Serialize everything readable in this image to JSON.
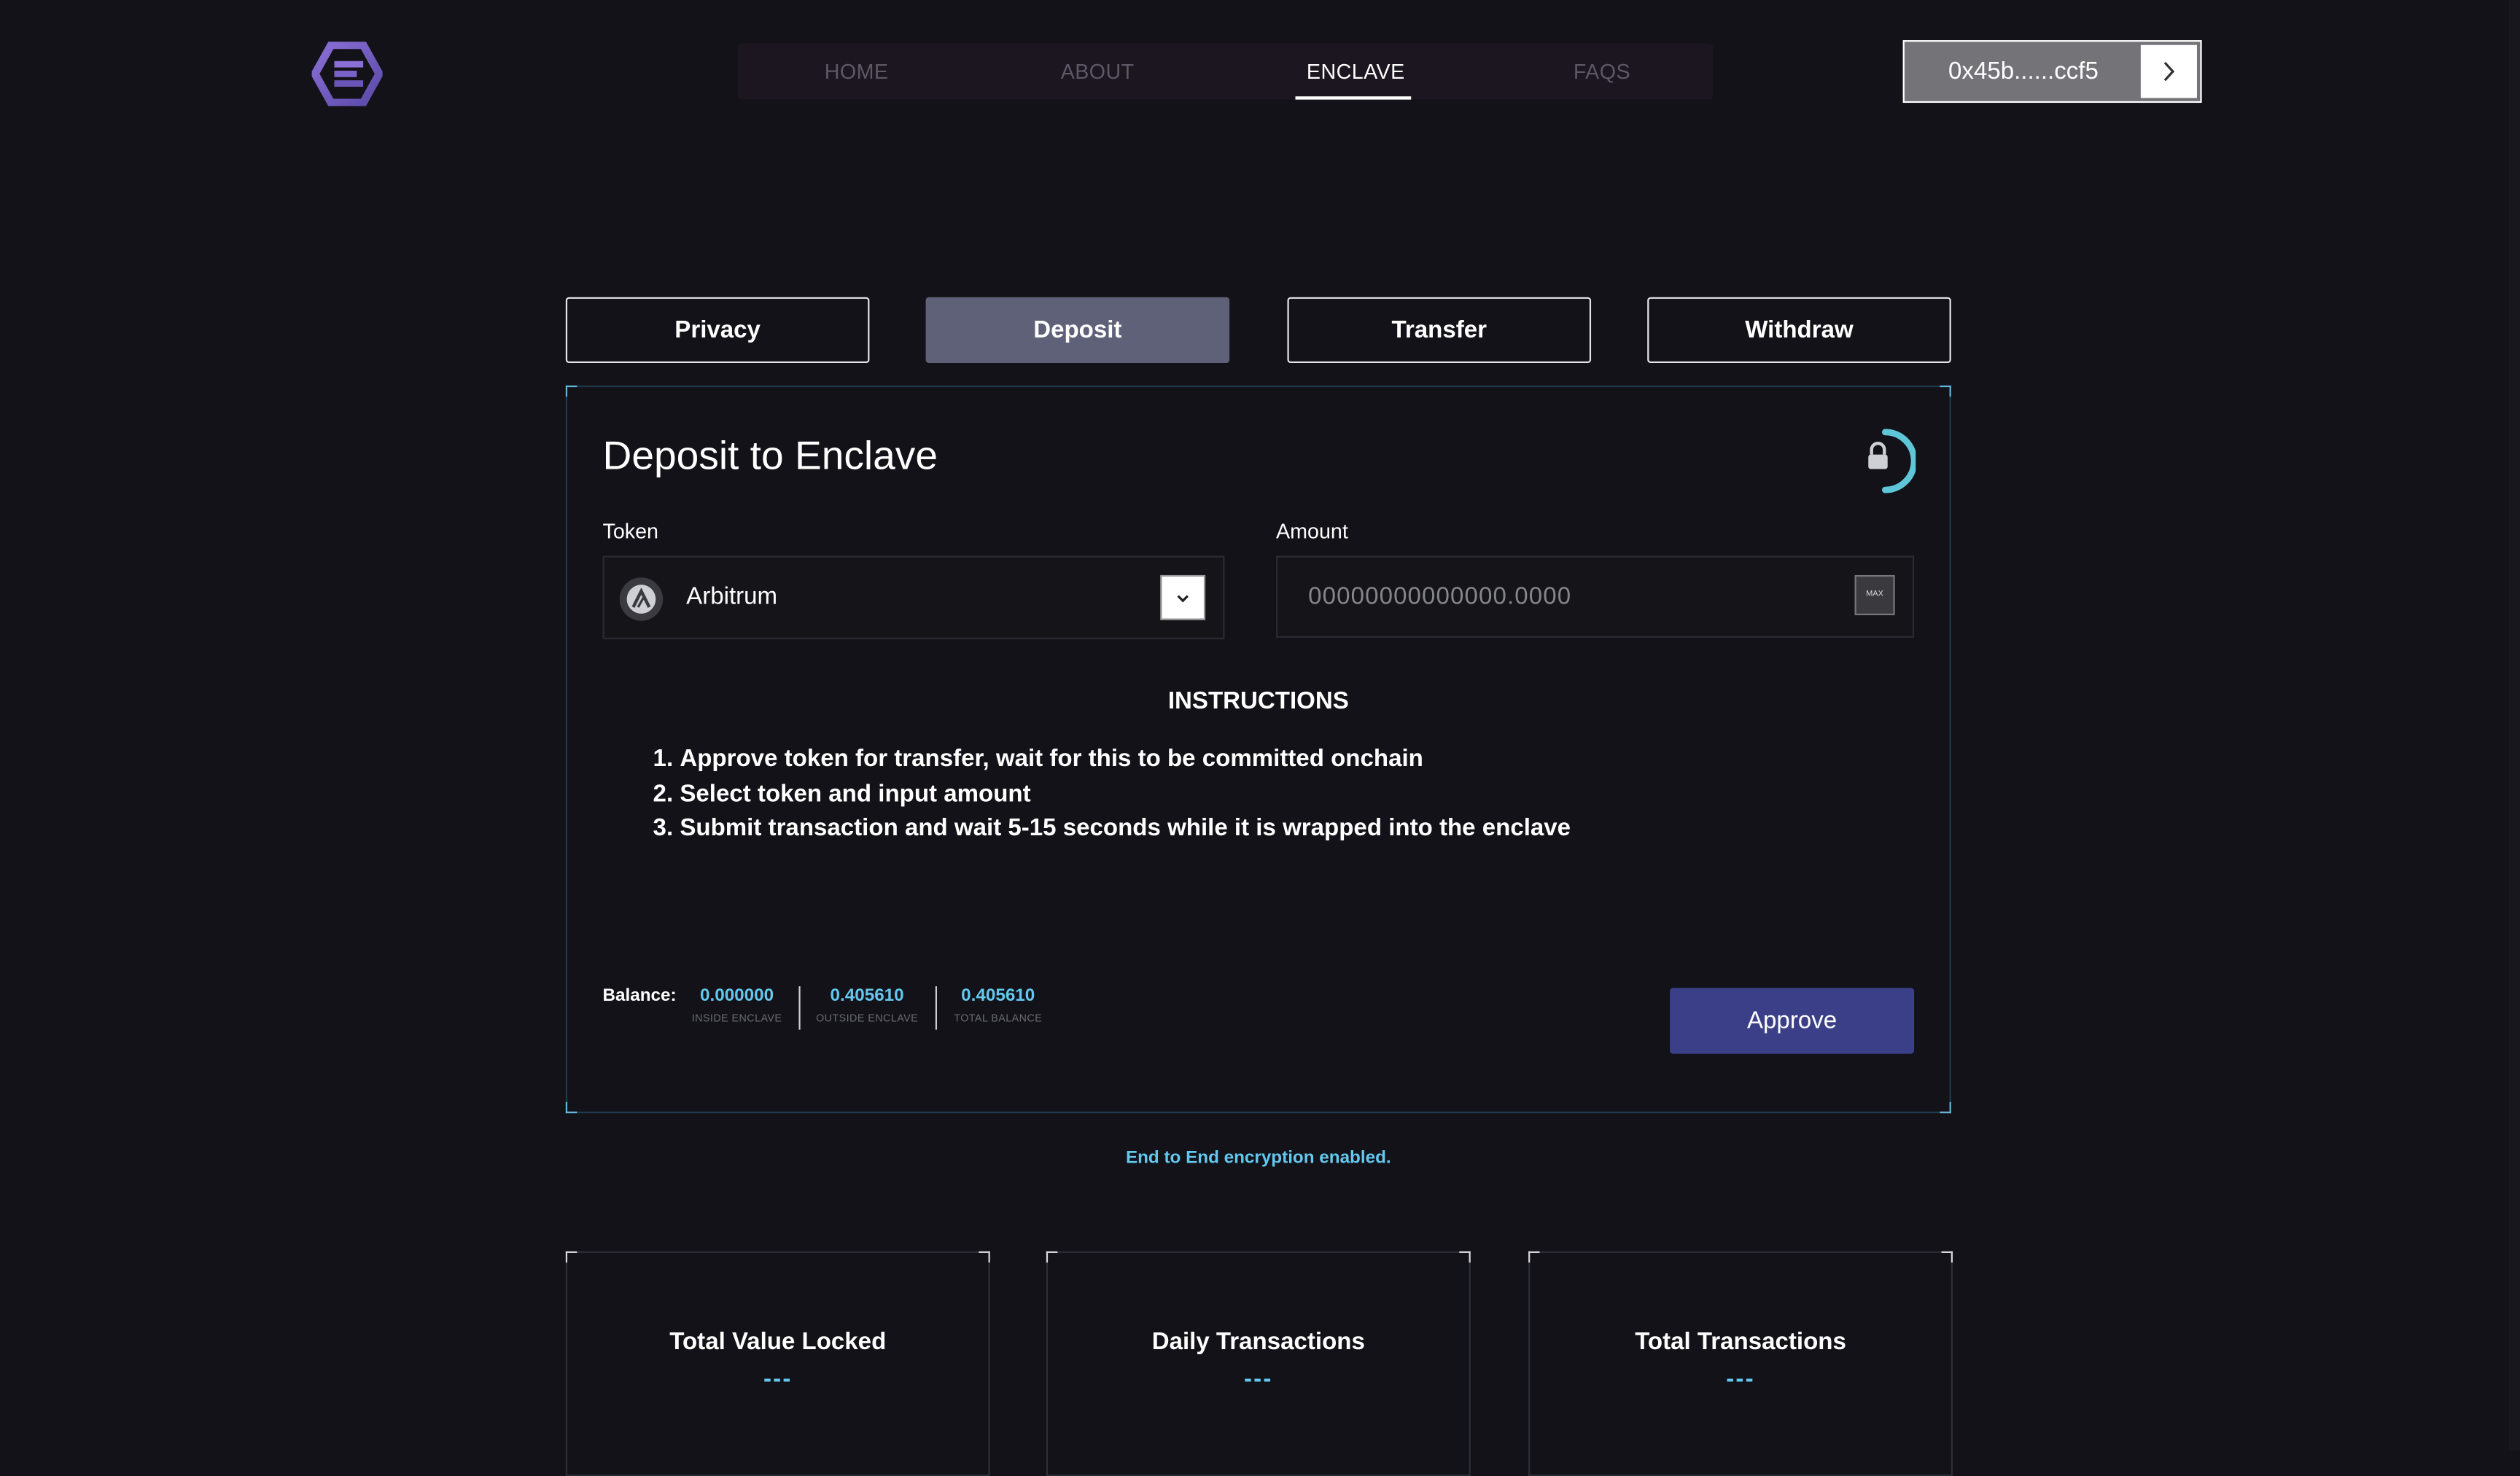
{
  "nav": {
    "items": [
      {
        "label": "HOME",
        "active": false
      },
      {
        "label": "ABOUT",
        "active": false
      },
      {
        "label": "ENCLAVE",
        "active": true
      },
      {
        "label": "FAQS",
        "active": false
      }
    ]
  },
  "wallet": {
    "address": "0x45b......ccf5",
    "arrow_icon": "chevron-right-icon"
  },
  "tabs": [
    {
      "label": "Privacy",
      "active": false
    },
    {
      "label": "Deposit",
      "active": true
    },
    {
      "label": "Transfer",
      "active": false
    },
    {
      "label": "Withdraw",
      "active": false
    }
  ],
  "panel": {
    "title": "Deposit to Enclave",
    "token_label": "Token",
    "token_value": "Arbitrum",
    "amount_label": "Amount",
    "amount_placeholder": "00000000000000.0000",
    "max_label": "MAX",
    "instructions_title": "INSTRUCTIONS",
    "instructions": [
      "Approve token for transfer, wait for this to be committed onchain",
      "Select token and input amount",
      "Submit transaction and wait 5-15 seconds while it is wrapped into the enclave"
    ],
    "balance": {
      "label": "Balance:",
      "inside_value": "0.000000",
      "inside_caption": "INSIDE ENCLAVE",
      "outside_value": "0.405610",
      "outside_caption": "OUTSIDE ENCLAVE",
      "total_value": "0.405610",
      "total_caption": "TOTAL BALANCE"
    },
    "approve_label": "Approve"
  },
  "encryption_note": "End to End encryption enabled.",
  "stats": [
    {
      "title": "Total Value Locked",
      "value": "---"
    },
    {
      "title": "Daily Transactions",
      "value": "---"
    },
    {
      "title": "Total Transactions",
      "value": "---"
    }
  ],
  "colors": {
    "background": "#121218",
    "accent": "#64c8ee",
    "approve": "#3b3f88",
    "active_tab": "#5f6178"
  }
}
